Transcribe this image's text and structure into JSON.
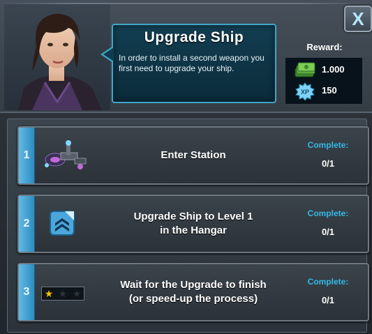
{
  "header": {
    "title": "Upgrade Ship",
    "description": "In order to install a second weapon you first need to upgrade your ship.",
    "reward_label": "Reward:",
    "rewards": [
      {
        "icon": "money-icon",
        "value": "1.000"
      },
      {
        "icon": "xp-icon",
        "value": "150"
      }
    ],
    "close_label": "X"
  },
  "tasks": [
    {
      "number": "1",
      "label": "Enter Station",
      "complete_label": "Complete:",
      "progress": "0/1",
      "icon": "station-icon"
    },
    {
      "number": "2",
      "label": "Upgrade Ship to Level 1\nin the Hangar",
      "complete_label": "Complete:",
      "progress": "0/1",
      "icon": "upgrade-chevron-icon"
    },
    {
      "number": "3",
      "label": "Wait for the Upgrade to finish\n(or speed-up the process)",
      "complete_label": "Complete:",
      "progress": "0/1",
      "icon": "stars-rating-icon",
      "stars_filled": 1,
      "stars_total": 3
    }
  ],
  "colors": {
    "accent": "#35b9e6",
    "number_tab": "#3fa0d6",
    "star_filled": "#f2c200",
    "star_empty": "#1c2328"
  }
}
